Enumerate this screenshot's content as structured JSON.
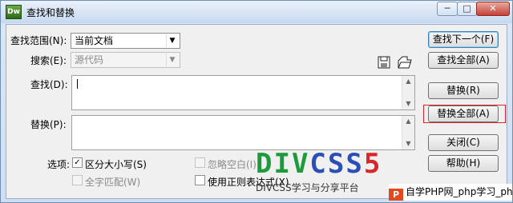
{
  "window": {
    "title": "查找和替换",
    "app_icon_text": "Dw",
    "controls": {
      "minimize": "─",
      "maximize": "□",
      "close": "✕"
    }
  },
  "form": {
    "find_in_label": "查找范围(N):",
    "find_in_value": "当前文档",
    "search_label": "搜索(E):",
    "search_value": "源代码",
    "find_label": "查找(D):",
    "find_value": "",
    "replace_label": "替换(P):",
    "replace_value": "",
    "options_label": "选项:",
    "options": {
      "match_case": {
        "label": "区分大小写(S)",
        "checked": true
      },
      "ignore_whitespace": {
        "label": "忽略空白(I)",
        "checked": false
      },
      "whole_word": {
        "label": "全字匹配(W)",
        "checked": false
      },
      "regex": {
        "label": "使用正则表达式(X)",
        "checked": false
      }
    }
  },
  "buttons": {
    "find_next": "查找下一个(F)",
    "find_all": "查找全部(A)",
    "replace": "替换(R)",
    "replace_all": "替换全部(A)",
    "close": "关闭(C)",
    "help": "帮助(H)"
  },
  "watermark": {
    "big_part1": "DIV",
    "big_part2": "CSS",
    "big_part3": "5",
    "sub": "DIVCSS学习与分享平台",
    "badge_text": "自学PHP网_php学习_php教",
    "badge_icon": "P"
  },
  "colors": {
    "highlight_box": "#d6262b",
    "title_gradient_top": "#e9f1fb"
  }
}
